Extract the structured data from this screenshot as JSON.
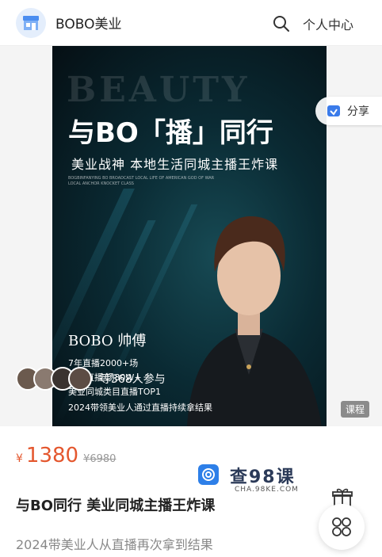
{
  "header": {
    "store_name": "BOBO美业",
    "personal_center": "个人中心",
    "logo_icon": "store-icon",
    "search_icon": "search-icon"
  },
  "poster": {
    "bg_word": "BEAUTY",
    "headline": "与BO「播」同行",
    "subtitle": "美业战神 本地生活同城主播王炸课",
    "tiny_text": "BOGBINFANYING BO BROADCAST LOCAL LIFE OF AMERICAN GOD OF WAR LOCAL ANCHOR KNOCKET CLASS",
    "name": "BOBO 帅傅",
    "line1": "7年直播2000+场",
    "line2": "同城直播 场30W+",
    "line3": "美业同城类目直播TOP1",
    "line4": "2024带领美业人通过直播持续拿结果"
  },
  "share": {
    "label": "分享",
    "icon": "share-icon"
  },
  "participants": {
    "text": "等368人参与",
    "avatar_count": 4
  },
  "tag": {
    "label": "课程"
  },
  "price": {
    "currency": "¥",
    "current": "1380",
    "original": "¥6980",
    "color": "#e4572e"
  },
  "product": {
    "title": "与BO同行 美业同城主播王炸课",
    "description": "2024带美业人从直播再次拿到结果"
  },
  "watermark": {
    "text": "查98课",
    "sub": "CHA.98KE.COM"
  },
  "floating": {
    "gift_icon": "gift-icon",
    "menu_icon": "grid-icon"
  },
  "colors": {
    "accent": "#2d7fe8",
    "price": "#e4572e"
  }
}
